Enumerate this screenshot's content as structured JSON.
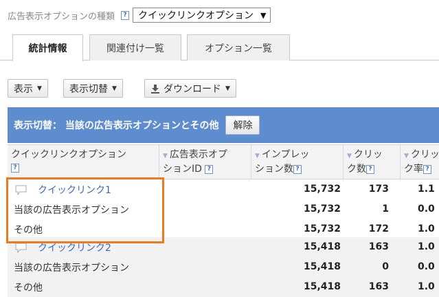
{
  "header": {
    "label": "広告表示オプションの種類",
    "help": "?",
    "select_value": "クイックリンクオプション",
    "select_arrow": "▼"
  },
  "tabs": [
    {
      "label": "統計情報",
      "active": true
    },
    {
      "label": "関連付け一覧",
      "active": false
    },
    {
      "label": "オプション一覧",
      "active": false
    }
  ],
  "toolbar": {
    "display_label": "表示",
    "switch_label": "表示切替",
    "download_label": "ダウンロード",
    "caret": "▼"
  },
  "filter": {
    "text": "表示切替： 当該の広告表示オプションとその他",
    "clear_label": "解除"
  },
  "table": {
    "headers": [
      {
        "line1": "クイックリンクオプション",
        "line2": "",
        "sort": false
      },
      {
        "line1": "広告表示オプ",
        "line2": "ションID",
        "sort": true
      },
      {
        "line1": "インプレッ",
        "line2": "ション数",
        "sort": true
      },
      {
        "line1": "クリッ",
        "line2": "ク数",
        "sort": true
      },
      {
        "line1": "クリッ",
        "line2": "ク率",
        "sort": true
      }
    ],
    "rows": [
      {
        "name": "クイックリンク1",
        "is_link": true,
        "impressions": "15,732",
        "clicks": "173",
        "ctr": "1.1"
      },
      {
        "name": "当該の広告表示オプション",
        "is_link": false,
        "impressions": "15,732",
        "clicks": "1",
        "ctr": "0.0"
      },
      {
        "name": "その他",
        "is_link": false,
        "impressions": "15,732",
        "clicks": "172",
        "ctr": "1.0"
      },
      {
        "name": "クイックリンク2",
        "is_link": true,
        "impressions": "15,418",
        "clicks": "163",
        "ctr": "1.0"
      },
      {
        "name": "当該の広告表示オプション",
        "is_link": false,
        "impressions": "15,418",
        "clicks": "0",
        "ctr": "0.0"
      },
      {
        "name": "その他",
        "is_link": false,
        "impressions": "15,418",
        "clicks": "163",
        "ctr": "1.0"
      }
    ]
  },
  "colors": {
    "filter_bar": "#5e8dcf",
    "link": "#3a66c4",
    "highlight": "#ee7a1c"
  }
}
